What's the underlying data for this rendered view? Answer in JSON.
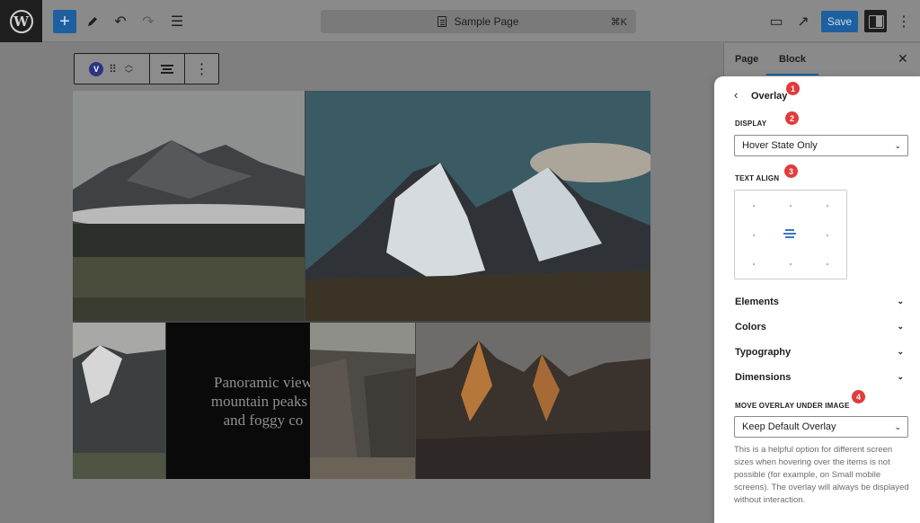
{
  "topbar": {
    "logo_glyph": "W",
    "add_glyph": "+",
    "tools_icon": "pencil-icon",
    "undo_glyph": "↶",
    "redo_glyph": "↷",
    "list_view_glyph": "☰",
    "document_title": "Sample Page",
    "shortcut": "⌘K",
    "preview_glyph": "▭",
    "view_glyph": "↗",
    "save_label": "Save",
    "more_glyph": "⋮"
  },
  "block_toolbar": {
    "block_badge": "V",
    "drag_glyph": "⠿",
    "move_up_glyph": "︿",
    "move_down_glyph": "﹀",
    "more_glyph": "⋮"
  },
  "gallery": {
    "caption": [
      "Panoramic view",
      "mountain peaks i",
      "and foggy co"
    ]
  },
  "sidebar": {
    "tabs": [
      "Page",
      "Block"
    ],
    "active_tab": "Block",
    "close_glyph": "✕",
    "back_glyph": "‹",
    "title": "Overlay",
    "badges": [
      "1",
      "2",
      "3",
      "4"
    ],
    "display_label": "DISPLAY",
    "display_value": "Hover State Only",
    "text_align_label": "TEXT ALIGN",
    "sections": [
      "Elements",
      "Colors",
      "Typography",
      "Dimensions"
    ],
    "move_overlay_label": "MOVE OVERLAY UNDER IMAGE",
    "move_overlay_value": "Keep Default Overlay",
    "help_text": "This is a helpful option for different screen sizes when hovering over the items is not possible (for example, on Small mobile screens). The overlay will always be displayed without interaction.",
    "chevron_glyph": "⌄"
  },
  "colors": {
    "accent": "#1d5fa0",
    "badge": "#e23b3b"
  }
}
